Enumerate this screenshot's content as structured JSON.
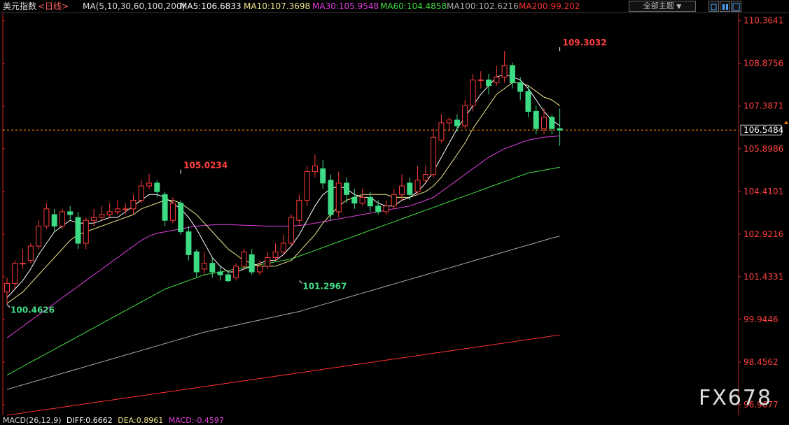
{
  "header": {
    "symbol": "美元指数",
    "period": "<日线>",
    "ma_params": "MA(5,10,30,60,100,200)",
    "ma5": "MA5:106.6833",
    "ma10": "MA10:107.3698",
    "ma30": "MA30:105.9548",
    "ma60": "MA60:104.4858",
    "ma100": "MA100:102.6216",
    "ma200": "MA200:99.202",
    "theme_button": "全部主题",
    "theme_arrow": "▼"
  },
  "macd": {
    "label": "MACD(26,12,9)",
    "diff": "DIFF:0.6662",
    "dea": "DEA:0.8961",
    "macd": "MACD:-0.4597"
  },
  "watermark": "FX678",
  "colors": {
    "up": "#ff3b3b",
    "down": "#3ddc84",
    "ma5": "#ffffff",
    "ma10": "#f0e68c",
    "ma30": "#e040e0",
    "ma60": "#44dd44",
    "ma100": "#aaaaaa",
    "ma200": "#ff3030",
    "axis": "#cc2222",
    "price_line": "#ff8c00"
  },
  "chart_data": {
    "type": "candlestick",
    "yticks": [
      "110.3641",
      "108.8756",
      "107.3871",
      "105.8986",
      "104.4101",
      "102.9216",
      "101.4331",
      "99.9446",
      "98.4562",
      "96.9677"
    ],
    "ylim": [
      96.6,
      110.6
    ],
    "current_price": "106.5484",
    "annotations": [
      {
        "label": "100.4626",
        "value": 100.4626,
        "index": 0
      },
      {
        "label": "105.0234",
        "value": 105.0234,
        "index": 22
      },
      {
        "label": "101.2967",
        "value": 101.2967,
        "index": 37
      },
      {
        "label": "109.3032",
        "value": 109.3032,
        "index": 84
      }
    ],
    "candles": [
      [
        100.9,
        101.2,
        101.4,
        100.46
      ],
      [
        101.2,
        101.9,
        102.0,
        101.0
      ],
      [
        101.9,
        101.9,
        102.4,
        101.7
      ],
      [
        102.0,
        102.5,
        102.6,
        101.9
      ],
      [
        102.5,
        103.2,
        103.4,
        102.4
      ],
      [
        103.2,
        103.8,
        104.0,
        103.1
      ],
      [
        103.6,
        103.2,
        103.8,
        103.0
      ],
      [
        103.2,
        103.7,
        103.8,
        103.1
      ],
      [
        103.7,
        103.6,
        103.9,
        103.4
      ],
      [
        103.5,
        102.6,
        103.7,
        102.4
      ],
      [
        102.6,
        103.4,
        103.5,
        102.4
      ],
      [
        103.4,
        103.5,
        103.8,
        103.2
      ],
      [
        103.5,
        103.6,
        103.9,
        103.4
      ],
      [
        103.6,
        103.7,
        104.0,
        103.5
      ],
      [
        103.7,
        103.8,
        104.1,
        103.6
      ],
      [
        103.8,
        103.8,
        104.0,
        103.6
      ],
      [
        103.8,
        104.1,
        104.3,
        103.6
      ],
      [
        104.1,
        104.6,
        104.8,
        104.0
      ],
      [
        104.6,
        104.7,
        105.02,
        104.5
      ],
      [
        104.7,
        104.4,
        104.8,
        104.2
      ],
      [
        104.3,
        103.4,
        104.4,
        103.2
      ],
      [
        103.4,
        104.0,
        104.2,
        103.3
      ],
      [
        104.0,
        103.0,
        104.1,
        102.9
      ],
      [
        103.0,
        102.2,
        103.2,
        102.0
      ],
      [
        102.3,
        101.6,
        102.4,
        101.4
      ],
      [
        101.7,
        101.9,
        102.3,
        101.5
      ],
      [
        101.9,
        101.6,
        102.1,
        101.4
      ],
      [
        101.6,
        101.5,
        101.8,
        101.3
      ],
      [
        101.5,
        101.29,
        101.6,
        101.25
      ],
      [
        101.4,
        101.8,
        101.9,
        101.3
      ],
      [
        101.8,
        102.3,
        102.4,
        101.7
      ],
      [
        102.2,
        101.6,
        102.4,
        101.5
      ],
      [
        101.6,
        101.8,
        102.0,
        101.5
      ],
      [
        101.8,
        102.1,
        102.3,
        101.7
      ],
      [
        102.1,
        102.3,
        102.6,
        102.0
      ],
      [
        102.3,
        102.6,
        102.9,
        102.2
      ],
      [
        102.6,
        103.5,
        103.6,
        102.5
      ],
      [
        103.4,
        104.1,
        104.3,
        103.2
      ],
      [
        104.1,
        105.1,
        105.3,
        103.9
      ],
      [
        105.1,
        105.3,
        105.7,
        104.9
      ],
      [
        105.2,
        104.7,
        105.5,
        104.5
      ],
      [
        104.8,
        103.6,
        105.0,
        103.4
      ],
      [
        103.7,
        104.7,
        105.1,
        103.5
      ],
      [
        104.7,
        104.3,
        104.9,
        104.0
      ],
      [
        104.2,
        104.0,
        104.5,
        103.8
      ],
      [
        104.0,
        104.2,
        104.5,
        103.9
      ],
      [
        104.2,
        103.9,
        104.4,
        103.7
      ],
      [
        103.9,
        103.7,
        104.1,
        103.6
      ],
      [
        103.7,
        103.9,
        104.1,
        103.6
      ],
      [
        103.9,
        104.3,
        104.5,
        103.8
      ],
      [
        104.3,
        104.6,
        105.0,
        104.1
      ],
      [
        104.7,
        104.3,
        104.9,
        104.1
      ],
      [
        104.4,
        104.8,
        105.3,
        104.3
      ],
      [
        104.8,
        105.0,
        105.3,
        104.7
      ],
      [
        105.0,
        106.3,
        106.6,
        104.9
      ],
      [
        106.2,
        106.8,
        107.1,
        106.1
      ],
      [
        106.8,
        106.9,
        107.0,
        106.5
      ],
      [
        106.9,
        106.7,
        107.1,
        106.5
      ],
      [
        106.7,
        107.4,
        107.6,
        106.6
      ],
      [
        107.4,
        108.3,
        108.5,
        107.2
      ],
      [
        108.3,
        108.3,
        108.6,
        108.0
      ],
      [
        108.3,
        108.1,
        108.5,
        107.8
      ],
      [
        108.2,
        108.4,
        108.8,
        108.1
      ],
      [
        108.4,
        108.8,
        109.3,
        108.2
      ],
      [
        108.8,
        108.2,
        108.9,
        108.0
      ],
      [
        108.2,
        107.9,
        108.4,
        107.6
      ],
      [
        107.9,
        107.2,
        108.1,
        107.0
      ],
      [
        107.2,
        106.6,
        107.4,
        106.4
      ],
      [
        106.6,
        107.0,
        107.3,
        106.4
      ],
      [
        107.0,
        106.6,
        107.1,
        106.4
      ],
      [
        106.6,
        106.55,
        107.3,
        106.0
      ]
    ],
    "ma5": [
      100.7,
      101.0,
      101.3,
      101.7,
      102.2,
      102.6,
      103.0,
      103.2,
      103.4,
      103.3,
      103.3,
      103.3,
      103.4,
      103.5,
      103.5,
      103.7,
      103.9,
      104.1,
      104.3,
      104.3,
      104.2,
      104.0,
      103.8,
      103.5,
      103.1,
      102.6,
      102.1,
      101.8,
      101.6,
      101.6,
      101.7,
      101.8,
      101.9,
      102.0,
      102.0,
      102.2,
      102.5,
      102.9,
      103.4,
      103.9,
      104.3,
      104.5,
      104.6,
      104.5,
      104.3,
      104.2,
      104.2,
      104.0,
      103.9,
      103.9,
      104.1,
      104.2,
      104.4,
      104.7,
      105.1,
      105.6,
      106.1,
      106.6,
      107.0,
      107.4,
      107.8,
      108.1,
      108.4,
      108.5,
      108.4,
      108.3,
      108.0,
      107.6,
      107.2,
      106.9,
      106.7
    ],
    "ma10": [
      100.5,
      100.7,
      100.9,
      101.2,
      101.5,
      101.8,
      102.1,
      102.4,
      102.7,
      102.9,
      103.0,
      103.1,
      103.2,
      103.3,
      103.4,
      103.5,
      103.6,
      103.8,
      103.9,
      104.0,
      104.1,
      104.1,
      104.0,
      103.8,
      103.6,
      103.3,
      103.0,
      102.7,
      102.4,
      102.2,
      102.0,
      101.9,
      101.8,
      101.8,
      101.8,
      101.9,
      102.0,
      102.3,
      102.6,
      102.9,
      103.3,
      103.6,
      103.9,
      104.1,
      104.2,
      104.3,
      104.3,
      104.3,
      104.3,
      104.2,
      104.2,
      104.2,
      104.3,
      104.4,
      104.6,
      104.9,
      105.3,
      105.7,
      106.1,
      106.6,
      107.0,
      107.4,
      107.8,
      108.0,
      108.2,
      108.2,
      108.1,
      107.9,
      107.7,
      107.6,
      107.4
    ],
    "ma30": [
      99.3,
      99.5,
      99.7,
      99.9,
      100.1,
      100.3,
      100.5,
      100.7,
      100.9,
      101.1,
      101.3,
      101.5,
      101.7,
      101.9,
      102.1,
      102.3,
      102.5,
      102.7,
      102.85,
      102.95,
      103.0,
      103.05,
      103.1,
      103.15,
      103.2,
      103.22,
      103.24,
      103.25,
      103.25,
      103.24,
      103.23,
      103.22,
      103.21,
      103.2,
      103.2,
      103.2,
      103.2,
      103.22,
      103.25,
      103.3,
      103.35,
      103.4,
      103.45,
      103.5,
      103.55,
      103.6,
      103.65,
      103.7,
      103.75,
      103.8,
      103.85,
      103.9,
      104.0,
      104.1,
      104.2,
      104.4,
      104.6,
      104.8,
      105.0,
      105.2,
      105.4,
      105.6,
      105.75,
      105.9,
      106.0,
      106.1,
      106.2,
      106.25,
      106.3,
      106.32,
      106.35
    ],
    "ma60": [
      98.0,
      98.15,
      98.3,
      98.45,
      98.6,
      98.75,
      98.9,
      99.05,
      99.2,
      99.35,
      99.5,
      99.65,
      99.8,
      99.95,
      100.1,
      100.25,
      100.4,
      100.55,
      100.7,
      100.85,
      101.0,
      101.1,
      101.2,
      101.3,
      101.4,
      101.5,
      101.55,
      101.6,
      101.65,
      101.7,
      101.75,
      101.8,
      101.85,
      101.9,
      101.95,
      102.0,
      102.05,
      102.15,
      102.25,
      102.35,
      102.45,
      102.55,
      102.65,
      102.75,
      102.85,
      102.95,
      103.05,
      103.15,
      103.25,
      103.35,
      103.45,
      103.55,
      103.65,
      103.75,
      103.85,
      103.95,
      104.05,
      104.15,
      104.25,
      104.35,
      104.45,
      104.55,
      104.65,
      104.75,
      104.85,
      104.95,
      105.05,
      105.1,
      105.15,
      105.2,
      105.25
    ],
    "ma100": [
      97.5,
      97.58,
      97.66,
      97.74,
      97.82,
      97.9,
      97.98,
      98.06,
      98.14,
      98.22,
      98.3,
      98.38,
      98.46,
      98.54,
      98.62,
      98.7,
      98.78,
      98.86,
      98.94,
      99.02,
      99.1,
      99.18,
      99.26,
      99.34,
      99.42,
      99.5,
      99.56,
      99.62,
      99.68,
      99.74,
      99.8,
      99.86,
      99.92,
      99.98,
      100.04,
      100.1,
      100.16,
      100.22,
      100.3,
      100.38,
      100.46,
      100.54,
      100.62,
      100.7,
      100.78,
      100.86,
      100.94,
      101.02,
      101.1,
      101.18,
      101.26,
      101.34,
      101.42,
      101.5,
      101.58,
      101.66,
      101.74,
      101.82,
      101.9,
      101.98,
      102.06,
      102.14,
      102.22,
      102.3,
      102.38,
      102.46,
      102.54,
      102.62,
      102.7,
      102.78,
      102.85
    ],
    "ma200": [
      96.6,
      96.64,
      96.68,
      96.72,
      96.76,
      96.8,
      96.84,
      96.88,
      96.92,
      96.96,
      97.0,
      97.04,
      97.08,
      97.12,
      97.16,
      97.2,
      97.24,
      97.28,
      97.32,
      97.36,
      97.4,
      97.44,
      97.48,
      97.52,
      97.56,
      97.6,
      97.64,
      97.68,
      97.72,
      97.76,
      97.8,
      97.84,
      97.88,
      97.92,
      97.96,
      98.0,
      98.04,
      98.08,
      98.12,
      98.16,
      98.2,
      98.24,
      98.28,
      98.32,
      98.36,
      98.4,
      98.44,
      98.48,
      98.52,
      98.56,
      98.6,
      98.64,
      98.68,
      98.72,
      98.76,
      98.8,
      98.84,
      98.88,
      98.92,
      98.96,
      99.0,
      99.04,
      99.08,
      99.12,
      99.16,
      99.2,
      99.24,
      99.28,
      99.32,
      99.36,
      99.4
    ]
  }
}
